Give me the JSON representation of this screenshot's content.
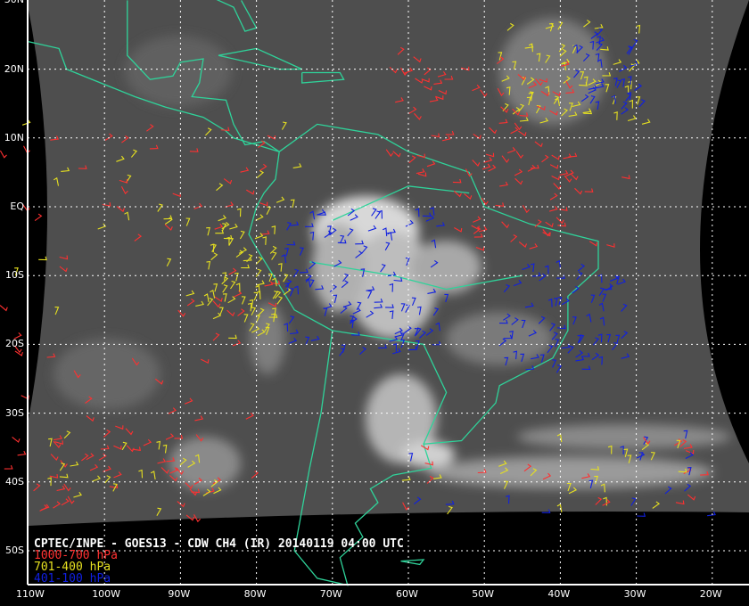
{
  "title": "CPTEC/INPE - GOES13 - CDW CH4 (IR) 20140119 04:00 UTC",
  "legend": [
    {
      "label": "1000-700 hPa",
      "color": "#ff3030"
    },
    {
      "label": "701-400 hPa",
      "color": "#e6e020"
    },
    {
      "label": "401-100 hPa",
      "color": "#1020e0"
    }
  ],
  "lat_labels": [
    "30N",
    "20N",
    "10N",
    "EQ",
    "10S",
    "20S",
    "30S",
    "40S",
    "50S"
  ],
  "lon_labels": [
    "110W",
    "100W",
    "90W",
    "80W",
    "70W",
    "60W",
    "50W",
    "40W",
    "30W",
    "20W"
  ],
  "colors": {
    "coastline": "#2fd39a",
    "grid": "#ffffff",
    "background": "#000000"
  }
}
